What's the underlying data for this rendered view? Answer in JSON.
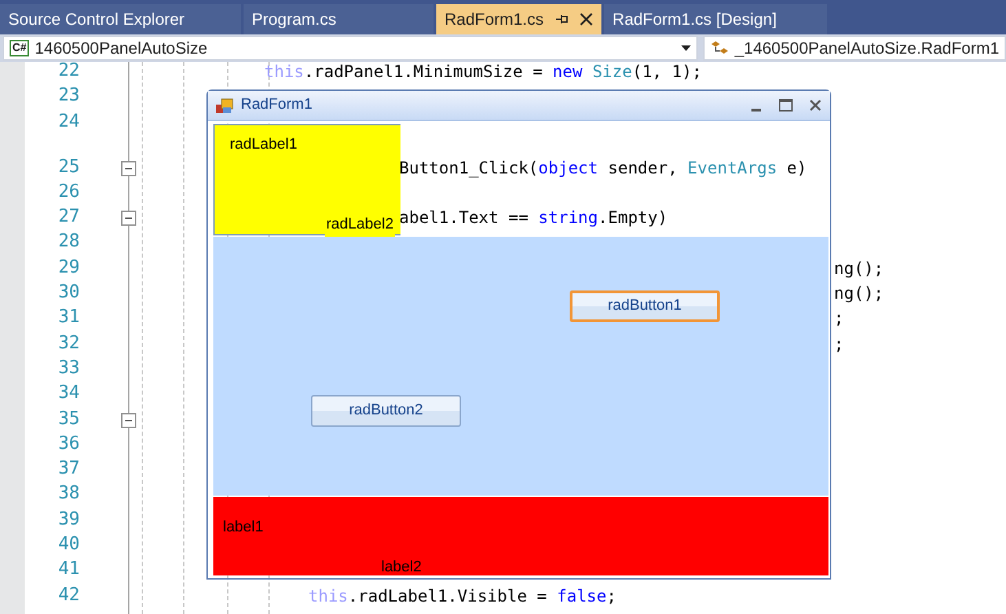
{
  "tabs": [
    {
      "label": "Source Control Explorer",
      "selected": false
    },
    {
      "label": "Program.cs",
      "selected": false
    },
    {
      "label": "RadForm1.cs",
      "selected": true
    },
    {
      "label": "RadForm1.cs [Design]",
      "selected": false
    }
  ],
  "navigation_bar": {
    "language_badge": "C#",
    "project": "1460500PanelAutoSize",
    "type": "_1460500PanelAutoSize.RadForm1"
  },
  "editor": {
    "lines": [
      {
        "number": "22",
        "fold_marker": false,
        "kind": "outer",
        "tokens": [
          {
            "text": "this",
            "kind": "qualifier"
          },
          {
            "text": ".radPanel1.MinimumSize = ",
            "kind": "plain"
          },
          {
            "text": "new ",
            "kind": "keyword"
          },
          {
            "text": "Size",
            "kind": "type"
          },
          {
            "text": "(1, 1);",
            "kind": "plain"
          }
        ]
      },
      {
        "number": "23",
        "fold_marker": false
      },
      {
        "number": "24",
        "fold_marker": false
      },
      {
        "number": "25",
        "fold_marker": true,
        "kind": "behind-form",
        "tokens": [
          {
            "text": "Button1_Click(",
            "kind": "plain"
          },
          {
            "text": "object",
            "kind": "keyword"
          },
          {
            "text": " sender, ",
            "kind": "plain"
          },
          {
            "text": "EventArgs",
            "kind": "type"
          },
          {
            "text": " e)",
            "kind": "plain"
          }
        ]
      },
      {
        "number": "26",
        "fold_marker": false
      },
      {
        "number": "27",
        "fold_marker": true,
        "kind": "behind-form",
        "tokens": [
          {
            "text": "abel1.Text == ",
            "kind": "plain"
          },
          {
            "text": "string",
            "kind": "keyword"
          },
          {
            "text": ".Empty)",
            "kind": "plain"
          }
        ]
      },
      {
        "number": "28",
        "fold_marker": false
      },
      {
        "number": "29",
        "fold_marker": false,
        "kind": "right-of-form",
        "tokens": [
          {
            "text": "ng();",
            "kind": "plain"
          }
        ]
      },
      {
        "number": "30",
        "fold_marker": false,
        "kind": "right-of-form",
        "tokens": [
          {
            "text": "ng();",
            "kind": "plain"
          }
        ]
      },
      {
        "number": "31",
        "fold_marker": false,
        "kind": "right-of-form",
        "tokens": [
          {
            "text": ";",
            "kind": "plain"
          }
        ]
      },
      {
        "number": "32",
        "fold_marker": false,
        "kind": "right-of-form",
        "tokens": [
          {
            "text": ";",
            "kind": "plain"
          }
        ]
      },
      {
        "number": "33",
        "fold_marker": false
      },
      {
        "number": "34",
        "fold_marker": false
      },
      {
        "number": "35",
        "fold_marker": true
      },
      {
        "number": "36",
        "fold_marker": false
      },
      {
        "number": "37",
        "fold_marker": false
      },
      {
        "number": "38",
        "fold_marker": false
      },
      {
        "number": "39",
        "fold_marker": false
      },
      {
        "number": "40",
        "fold_marker": false
      },
      {
        "number": "41",
        "fold_marker": false
      },
      {
        "number": "42",
        "fold_marker": false,
        "kind": "inner",
        "tokens": [
          {
            "text": "this",
            "kind": "qualifier"
          },
          {
            "text": ".radLabel1.Visible = ",
            "kind": "plain"
          },
          {
            "text": "false",
            "kind": "keyword"
          },
          {
            "text": ";",
            "kind": "plain"
          }
        ]
      }
    ]
  },
  "form": {
    "title": "RadForm1",
    "top_panel": {
      "label_1": "radLabel1",
      "label_2": "radLabel2"
    },
    "buttons": [
      {
        "label": "radButton1",
        "focused": true
      },
      {
        "label": "radButton2",
        "focused": false
      }
    ],
    "bottom_panel": {
      "label_1": "label1",
      "label_2": "label2"
    }
  }
}
